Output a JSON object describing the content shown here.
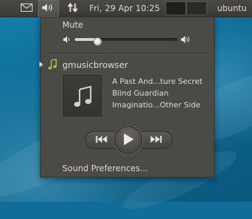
{
  "panel": {
    "clock": "Fri, 29 Apr  10:25",
    "user": "ubuntu",
    "icons": [
      "mail-icon",
      "volume-icon",
      "network-transfer-icon"
    ]
  },
  "sound_menu": {
    "mute_label": "Mute",
    "volume_level": 0.22,
    "player": {
      "name": "gmusicbrowser",
      "track_title": "A Past And...ture Secret",
      "artist": "Blind Guardian",
      "album": "Imaginatio...Other Side"
    },
    "controls": [
      "previous",
      "play",
      "next"
    ],
    "preferences_label": "Sound Preferences..."
  }
}
